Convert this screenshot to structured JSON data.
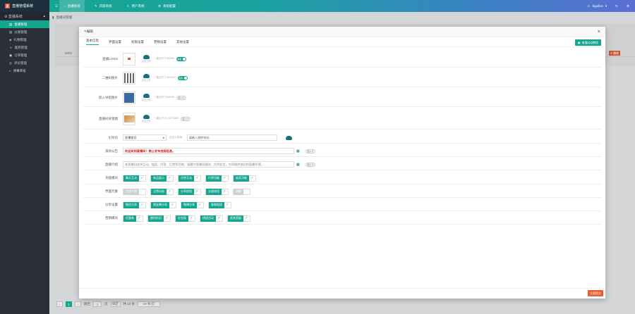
{
  "app": {
    "title": "直播管理系统"
  },
  "topnav": {
    "tabs": [
      {
        "label": "直播系统",
        "icon": "home-icon"
      },
      {
        "label": "内容系统",
        "icon": "edit-icon"
      },
      {
        "label": "用户系统",
        "icon": "user-icon"
      },
      {
        "label": "系统配置",
        "icon": "gear-icon"
      }
    ],
    "user": "bigolive"
  },
  "sidebar": {
    "header": "直播系统",
    "items": [
      {
        "label": "直播管理"
      },
      {
        "label": "分类管理"
      },
      {
        "label": "礼物管理"
      },
      {
        "label": "嘉宾管理"
      },
      {
        "label": "订单管理"
      },
      {
        "label": "评论管理"
      },
      {
        "label": "弹幕审核"
      }
    ]
  },
  "main": {
    "breadcrumb": "直播间管理",
    "bg_row_id": "8000",
    "bg_badge": "删除",
    "pager": {
      "total": "共 10 条",
      "goto": "跳至",
      "page": "1",
      "unit": "页",
      "confirm": "确定",
      "page_size": "10 条/页"
    }
  },
  "modal": {
    "title": "编辑",
    "close": "×",
    "tabs": [
      {
        "label": "基本信息"
      },
      {
        "label": "界面设置"
      },
      {
        "label": "权限设置"
      },
      {
        "label": "营销设置"
      },
      {
        "label": "其他设置"
      }
    ],
    "tutorial_button": "查看QQ教程",
    "images": [
      {
        "label": "直播LOGO",
        "hint": "* 建议尺寸200*60",
        "upload": "点击上传",
        "switch": "启用",
        "on": true
      },
      {
        "label": "二维码图片",
        "hint": "* 建议尺寸200*200",
        "upload": "点击上传",
        "switch": "启用",
        "on": true
      },
      {
        "label": "嵌入导航图片",
        "hint": "* 建议尺寸600*60",
        "upload": "点击上传",
        "switch": "关闭",
        "on": false
      },
      {
        "label": "直播间背景图",
        "hint": "* 建议尺寸1920*1080",
        "upload": "点击上传",
        "switch": "关闭",
        "on": false
      }
    ],
    "custom_menu": {
      "label": "引导页",
      "select": "直播首页",
      "input_label": "自定义菜单：",
      "input": "请输入跳转地址"
    },
    "notice": {
      "label": "滚动公告",
      "text": "欢迎来到直播间！禁止发布违规信息。",
      "switch": "关闭"
    },
    "desc": {
      "label": "直播介绍",
      "text": "本直播间支持互动、抽奖、问答、打赏等功能，请遵守直播间规则，文明发言，共同维护良好的直播环境。",
      "switch": "关闭"
    },
    "functions": [
      {
        "label": "功能模块",
        "chips": [
          {
            "label": "聊天互动",
            "on": true
          },
          {
            "label": "商品展示",
            "on": true
          },
          {
            "label": "问答互动",
            "on": true
          },
          {
            "label": "打赏功能",
            "on": true
          },
          {
            "label": "抽奖功能",
            "on": true
          }
        ]
      },
      {
        "label": "界面元素",
        "chips": [
          {
            "label": "在线人数",
            "on": false
          },
          {
            "label": "点赞动画",
            "on": true
          },
          {
            "label": "分享按钮",
            "on": true
          },
          {
            "label": "全屏按钮",
            "on": true
          },
          {
            "label": "弹幕",
            "on": false
          }
        ]
      },
      {
        "label": "分享设置",
        "chips": [
          {
            "label": "微信分享",
            "on": true
          },
          {
            "label": "朋友圈分享",
            "on": true
          },
          {
            "label": "微博分享",
            "on": true
          },
          {
            "label": "复制链接",
            "on": true
          }
        ]
      },
      {
        "label": "营销模块",
        "chips": [
          {
            "label": "优惠券",
            "on": true
          },
          {
            "label": "限时折扣",
            "on": true
          },
          {
            "label": "红包雨",
            "on": true
          },
          {
            "label": "拼团活动",
            "on": true
          },
          {
            "label": "签到奖励",
            "on": true
          }
        ]
      }
    ],
    "save": "立即提交"
  }
}
